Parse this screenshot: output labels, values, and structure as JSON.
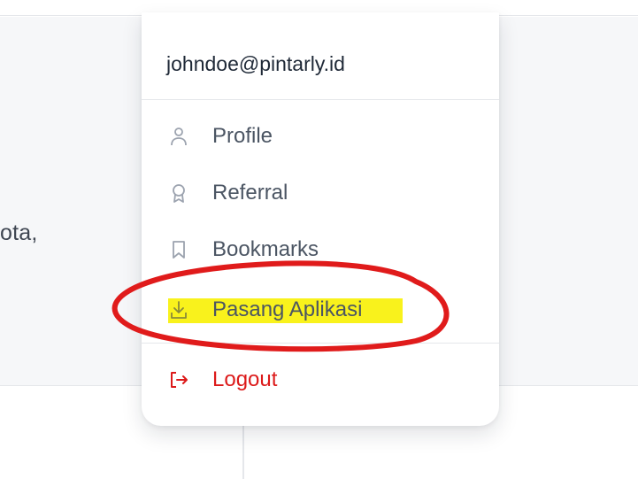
{
  "background": {
    "partial_text": "ota,"
  },
  "dropdown": {
    "email": "johndoe@pintarly.id",
    "items": [
      {
        "label": "Profile",
        "icon": "user-icon"
      },
      {
        "label": "Referral",
        "icon": "award-icon"
      },
      {
        "label": "Bookmarks",
        "icon": "bookmark-icon"
      },
      {
        "label": "Pasang Aplikasi",
        "icon": "download-icon",
        "highlighted": true
      }
    ],
    "logout": {
      "label": "Logout",
      "icon": "logout-icon"
    }
  },
  "colors": {
    "text_primary": "#1f2937",
    "menu_text": "#4b5563",
    "logout": "#dc1a1a",
    "highlight": "#f9f21c",
    "annotation_circle": "#e01b1b"
  }
}
